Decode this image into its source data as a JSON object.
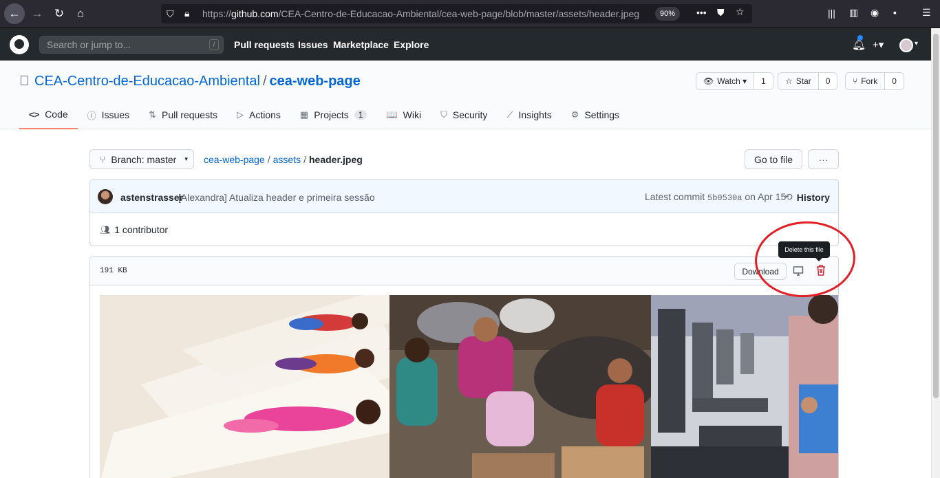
{
  "browser": {
    "url_prefix": "https://",
    "url_host": "github.com",
    "url_path": "/CEA-Centro-de-Educacao-Ambiental/cea-web-page/blob/master/assets/header.jpeg",
    "zoom": "90%"
  },
  "header": {
    "search_placeholder": "Search or jump to...",
    "slash_key": "/",
    "nav": [
      "Pull requests",
      "Issues",
      "Marketplace",
      "Explore"
    ],
    "plus": "+▾"
  },
  "repo": {
    "owner": "CEA-Centro-de-Educacao-Ambiental",
    "separator": "/",
    "name": "cea-web-page",
    "watch": {
      "label": "Watch ▾",
      "count": "1"
    },
    "star": {
      "label": "Star",
      "count": "0"
    },
    "fork": {
      "label": "Fork",
      "count": "0"
    }
  },
  "tabs": [
    {
      "label": "Code",
      "icon": "<>"
    },
    {
      "label": "Issues",
      "icon": "ⓘ"
    },
    {
      "label": "Pull requests",
      "icon": "⇅"
    },
    {
      "label": "Actions",
      "icon": "▷"
    },
    {
      "label": "Projects",
      "icon": "▦",
      "counter": "1"
    },
    {
      "label": "Wiki",
      "icon": "📖"
    },
    {
      "label": "Security",
      "icon": "⛉"
    },
    {
      "label": "Insights",
      "icon": "⟋"
    },
    {
      "label": "Settings",
      "icon": "⚙"
    }
  ],
  "branch": {
    "prefix": "Branch:",
    "name": "master"
  },
  "breadcrumb": {
    "repo": "cea-web-page",
    "folder": "assets",
    "file": "header.jpeg"
  },
  "actions": {
    "goto_file": "Go to file",
    "more": "···"
  },
  "commit": {
    "author": "astenstrasser",
    "message": "[Alexandra] Atualiza header e primeira sessão",
    "latest_label": "Latest commit",
    "sha": "5b0530a",
    "date": "on Apr 15",
    "history": "History"
  },
  "contributors": "1 contributor",
  "file": {
    "size": "191 KB",
    "download": "Download",
    "tooltip": "Delete this file"
  },
  "colors": {
    "link": "#0366d6",
    "header_bg": "#24292e",
    "delete": "#cb2431",
    "highlight_circle": "#e31e24",
    "active_tab": "#f9826c"
  }
}
